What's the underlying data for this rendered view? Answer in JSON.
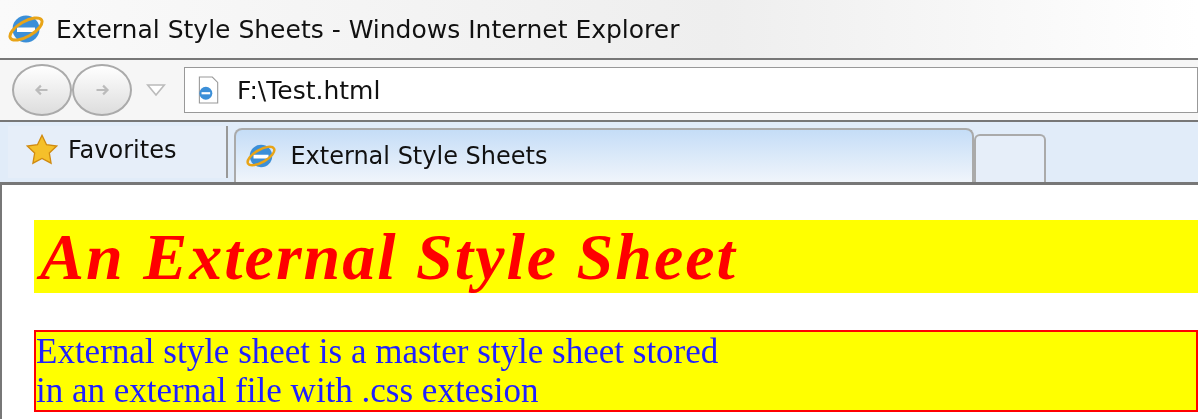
{
  "window": {
    "title": "External Style Sheets - Windows Internet Explorer"
  },
  "address_bar": {
    "value": "F:\\Test.html"
  },
  "favorites": {
    "label": "Favorites"
  },
  "tabs": [
    {
      "label": "External Style Sheets",
      "selected": true
    }
  ],
  "page": {
    "heading": "An External Style Sheet",
    "paragraph_lines": [
      "External style sheet is a master style sheet stored",
      "in an external file with .css extesion"
    ]
  }
}
